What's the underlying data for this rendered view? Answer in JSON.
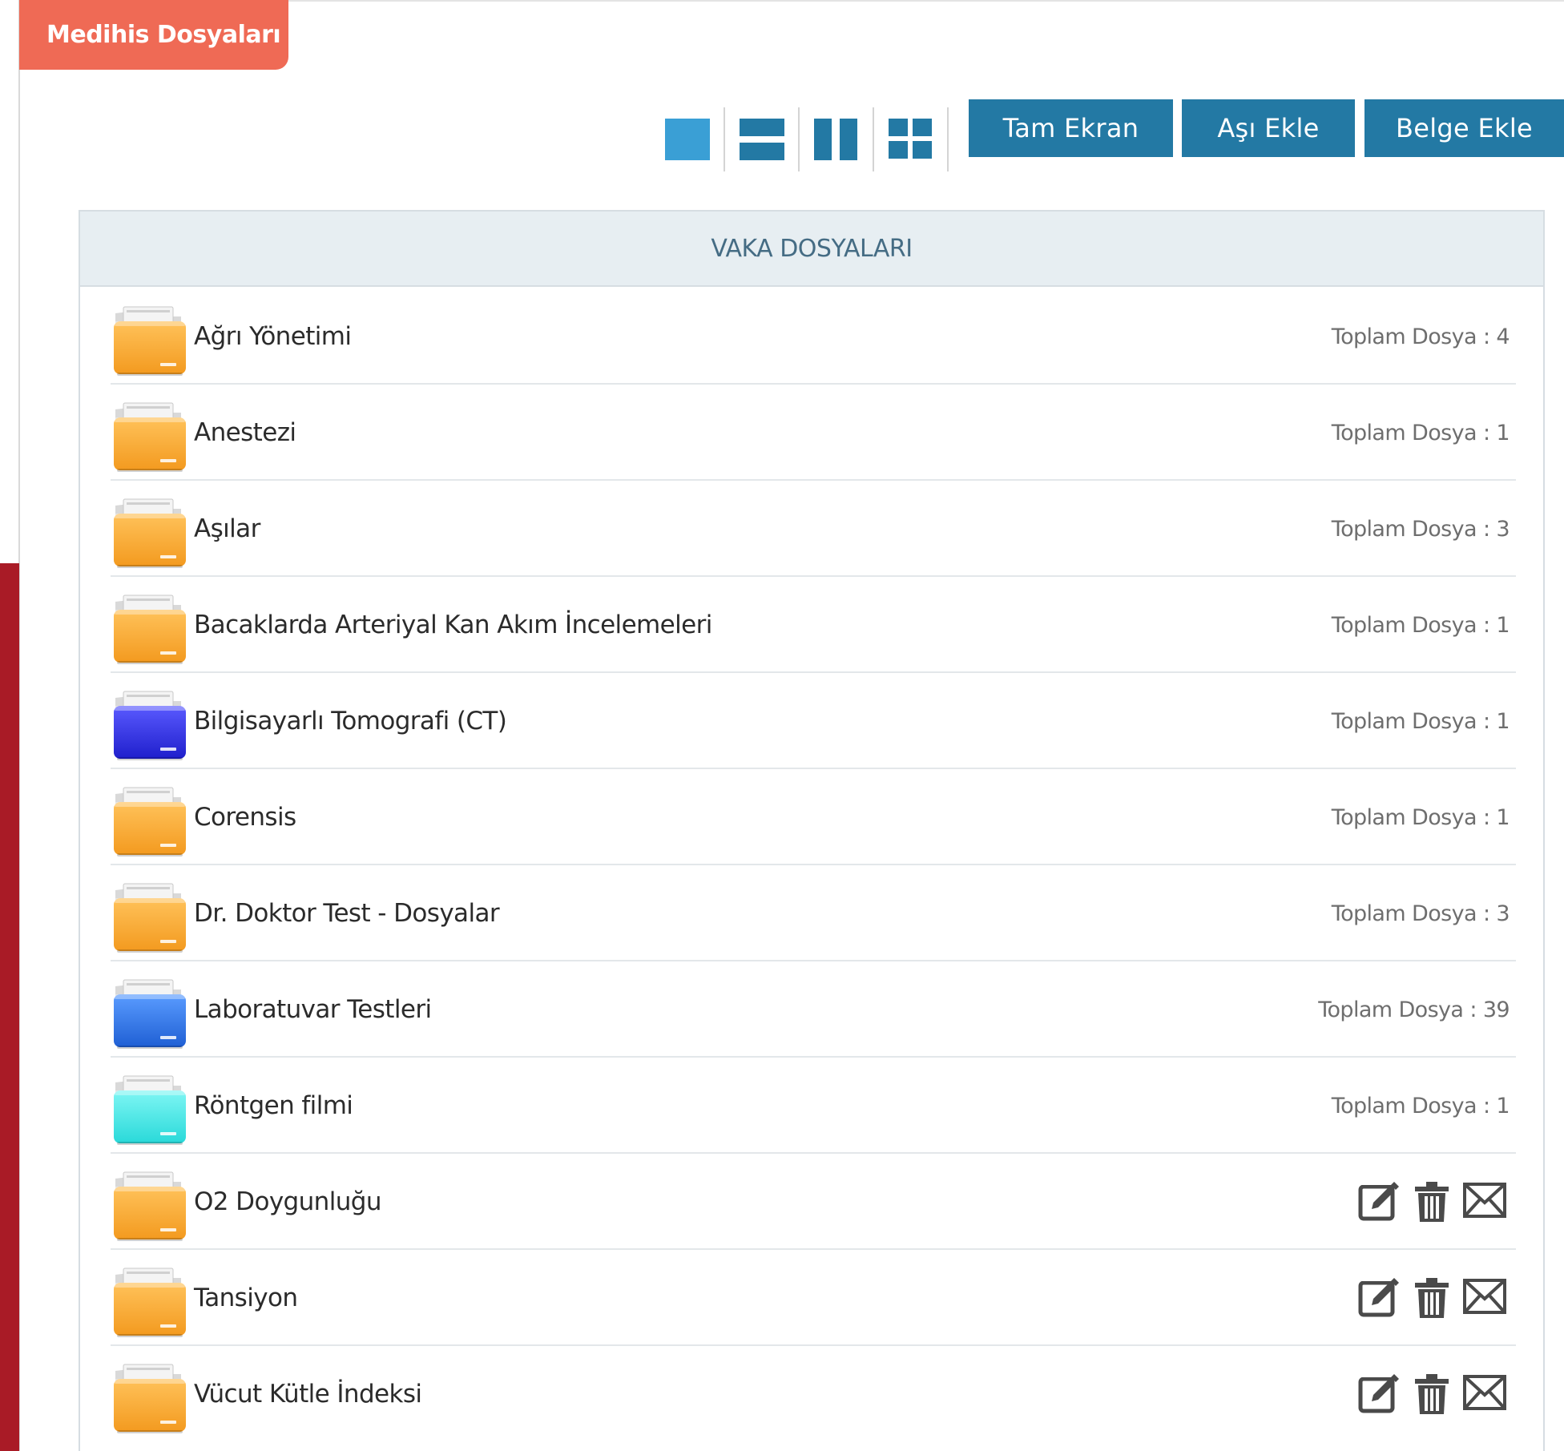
{
  "page_tab": {
    "label": "Medihis Dosyaları"
  },
  "view_modes": [
    {
      "id": "single",
      "icon": "single-view-icon",
      "active": true
    },
    {
      "id": "rows",
      "icon": "rows-view-icon",
      "active": false
    },
    {
      "id": "columns",
      "icon": "columns-view-icon",
      "active": false
    },
    {
      "id": "grid",
      "icon": "grid-view-icon",
      "active": false
    }
  ],
  "toolbar": {
    "fullscreen_label": "Tam Ekran",
    "add_vaccine_label": "Aşı Ekle",
    "add_document_label": "Belge Ekle"
  },
  "panel": {
    "title": "VAKA DOSYALARI",
    "files": [
      {
        "name": "Ağrı Yönetimi",
        "count": "Toplam Dosya : 4",
        "color": "orange"
      },
      {
        "name": "Anestezi",
        "count": "Toplam Dosya : 1",
        "color": "orange"
      },
      {
        "name": "Aşılar",
        "count": "Toplam Dosya : 3",
        "color": "orange"
      },
      {
        "name": "Bacaklarda Arteriyal Kan Akım İncelemeleri",
        "count": "Toplam Dosya : 1",
        "color": "orange"
      },
      {
        "name": "Bilgisayarlı Tomografi (CT)",
        "count": "Toplam Dosya : 1",
        "color": "indigo"
      },
      {
        "name": "Corensis",
        "count": "Toplam Dosya : 1",
        "color": "orange"
      },
      {
        "name": "Dr. Doktor Test - Dosyalar",
        "count": "Toplam Dosya : 3",
        "color": "orange"
      },
      {
        "name": "Laboratuvar Testleri",
        "count": "Toplam Dosya : 39",
        "color": "blue"
      },
      {
        "name": "Röntgen filmi",
        "count": "Toplam Dosya : 1",
        "color": "cyan"
      },
      {
        "name": "O2 Doygunluğu",
        "actions": [
          "edit-icon",
          "trash-icon",
          "mail-icon"
        ],
        "color": "orange"
      },
      {
        "name": "Tansiyon",
        "actions": [
          "edit-icon",
          "trash-icon",
          "mail-icon"
        ],
        "color": "orange"
      },
      {
        "name": "Vücut Kütle İndeksi",
        "actions": [
          "edit-icon",
          "trash-icon",
          "mail-icon"
        ],
        "color": "orange"
      }
    ]
  },
  "colors": {
    "tab_background": "#ef6a55",
    "button_background": "#2379a4",
    "view_active": "#3a9fd5",
    "view_inactive": "#2379a4",
    "panel_header_background": "#e7eef2",
    "panel_title": "#456c84",
    "left_accent": "#a91b26",
    "folder_orange": [
      "#ffc25a",
      "#f39a1f"
    ],
    "folder_indigo": [
      "#5a5aff",
      "#1f1fcc"
    ],
    "folder_blue": [
      "#5a9cff",
      "#1f5fd4"
    ],
    "folder_cyan": [
      "#7ff6f4",
      "#29d9d9"
    ]
  }
}
